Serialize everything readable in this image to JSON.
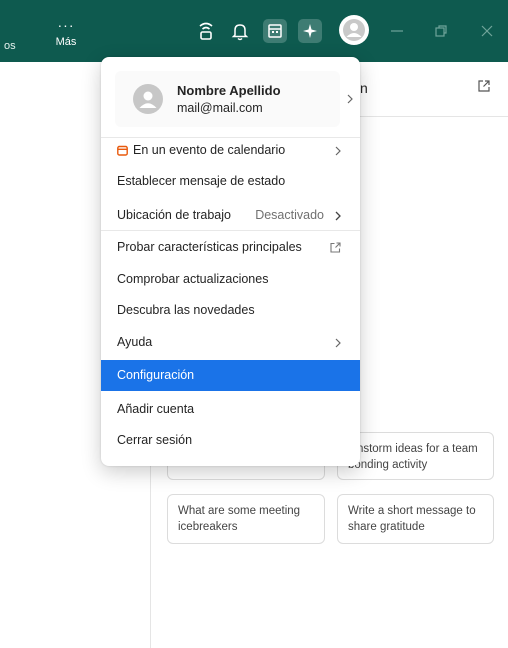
{
  "topbar": {
    "left_text": "os",
    "more_label": "Más",
    "more_dots": "···"
  },
  "background": {
    "header_fragment": "n",
    "cards": [
      {
        "text": "ainstorm ideas for a team bonding activity"
      },
      {
        "text": "What are some meeting icebreakers"
      },
      {
        "text": "Write a short message to share gratitude"
      }
    ]
  },
  "menu": {
    "profile": {
      "name": "Nombre Apellido",
      "email": "mail@mail.com"
    },
    "calendar_item": "En un evento de calendario",
    "status_item": "Establecer mensaje de estado",
    "location_item": "Ubicación de trabajo",
    "location_value": "Desactivado",
    "features_item": "Probar características principales",
    "updates_item": "Comprobar actualizaciones",
    "news_item": "Descubra las novedades",
    "help_item": "Ayuda",
    "settings_item": "Configuración",
    "add_account_item": "Añadir cuenta",
    "logout_item": "Cerrar sesión"
  },
  "colors": {
    "topbar": "#0e5a4f",
    "accent": "#1a73e8",
    "calendar_icon": "#e8590c"
  }
}
